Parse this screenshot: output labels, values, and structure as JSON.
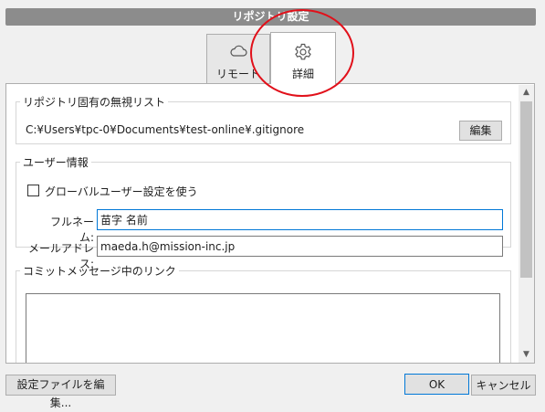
{
  "window": {
    "title": "リポジトリ設定"
  },
  "tabs": [
    {
      "label": "リモート",
      "icon": "cloud-icon",
      "selected": false
    },
    {
      "label": "詳細",
      "icon": "gear-icon",
      "selected": true
    }
  ],
  "ignore_group": {
    "legend": "リポジトリ固有の無視リスト",
    "path": "C:¥Users¥tpc-0¥Documents¥test-online¥.gitignore",
    "edit_button": "編集"
  },
  "user_group": {
    "legend": "ユーザー情報",
    "use_global_label": "グローバルユーザー設定を使う",
    "use_global_checked": false,
    "fullname_label": "フルネーム:",
    "fullname_value": "苗字 名前",
    "email_label": "メールアドレス:",
    "email_value": "maeda.h@mission-inc.jp"
  },
  "links_group": {
    "legend": "コミットメッセージ中のリンク"
  },
  "footer": {
    "edit_config_button": "設定ファイルを編集...",
    "ok_button": "OK",
    "cancel_button": "キャンセル"
  },
  "colors": {
    "highlight_circle": "#e1101a",
    "focus_border": "#0078d7",
    "titlebar": "#8c8c8c"
  }
}
